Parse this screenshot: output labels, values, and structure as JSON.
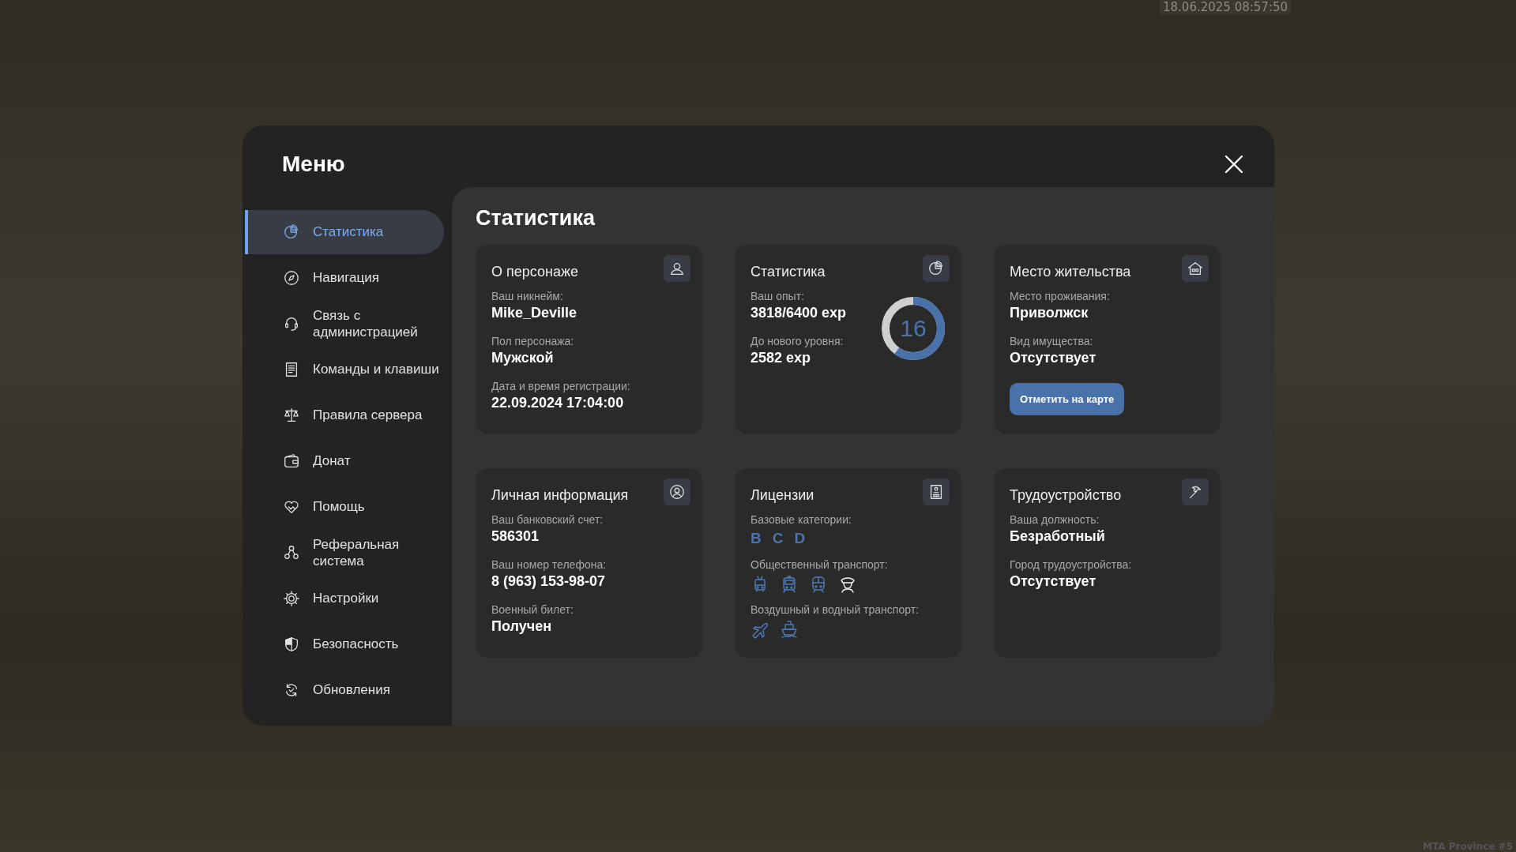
{
  "hud": {
    "timestamp": "18.06.2025 08:57:50",
    "server": "MTA Province #5"
  },
  "menu": {
    "title": "Меню",
    "sidebar": {
      "items": [
        {
          "label": "Статистика",
          "kind": "pie",
          "selected": true
        },
        {
          "label": "Навигация",
          "kind": "compass",
          "selected": false
        },
        {
          "label": "Связь с администрацией",
          "kind": "headset",
          "selected": false
        },
        {
          "label": "Команды и клавиши",
          "kind": "document",
          "selected": false
        },
        {
          "label": "Правила сервера",
          "kind": "scales",
          "selected": false
        },
        {
          "label": "Донат",
          "kind": "wallet",
          "selected": false
        },
        {
          "label": "Помощь",
          "kind": "heart",
          "selected": false
        },
        {
          "label": "Реферальная система",
          "kind": "network",
          "selected": false
        },
        {
          "label": "Настройки",
          "kind": "gear",
          "selected": false
        },
        {
          "label": "Безопасность",
          "kind": "shield",
          "selected": false
        },
        {
          "label": "Обновления",
          "kind": "refresh",
          "selected": false
        }
      ]
    },
    "content": {
      "title": "Статистика",
      "cards": [
        {
          "kind": "fields",
          "title": "О персонаже",
          "fields": [
            {
              "label": "Ваш никнейм:",
              "value": "Mike_Deville"
            },
            {
              "label": "Пол персонажа:",
              "value": "Мужской"
            },
            {
              "label": "Дата и время регистрации:",
              "value": "22.09.2024 17:04:00"
            }
          ]
        },
        {
          "kind": "level",
          "title": "Статистика",
          "fields": [
            {
              "label": "Ваш опыт:",
              "value": "3818/6400 exp"
            },
            {
              "label": "До нового уровня:",
              "value": "2582 exp"
            }
          ],
          "ring": {
            "value": "16",
            "level": 0.6
          }
        },
        {
          "kind": "fields",
          "title": "Место жительства",
          "fields": [
            {
              "label": "Место проживания:",
              "value": "Приволжск"
            },
            {
              "label": "Вид имущества:",
              "value": "Отсутствует"
            }
          ],
          "button": "Отметить на карте"
        },
        {
          "kind": "fields",
          "title": "Личная информация",
          "fields": [
            {
              "label": "Ваш банковский счет:",
              "value": "586301"
            },
            {
              "label": "Ваш номер телефона:",
              "value": "8 (963) 153-98-07"
            },
            {
              "label": "Военный билет:",
              "value": "Получен"
            }
          ]
        },
        {
          "kind": "licenses",
          "title": "Лицензии",
          "sections": [
            {
              "kind": "letters",
              "label": "Базовые категории:",
              "letters": [
                "B",
                "C",
                "D"
              ]
            },
            {
              "kind": "icons",
              "label": "Общественный транспорт:",
              "icons": [
                {
                  "kind": "trolleybus",
                  "active": true
                },
                {
                  "kind": "tram",
                  "active": true
                },
                {
                  "kind": "train",
                  "active": true
                },
                {
                  "kind": "driver",
                  "active": false
                }
              ]
            },
            {
              "kind": "icons",
              "label": "Воздушный и водный транспорт:",
              "icons": [
                {
                  "kind": "plane",
                  "active": true
                },
                {
                  "kind": "ship",
                  "active": true
                }
              ]
            }
          ]
        },
        {
          "kind": "fields",
          "title": "Трудоустройство",
          "fields": [
            {
              "label": "Ваша должность:",
              "value": "Безработный"
            },
            {
              "label": "Город трудоустройства:",
              "value": "Отсутствует"
            }
          ]
        }
      ]
    }
  }
}
